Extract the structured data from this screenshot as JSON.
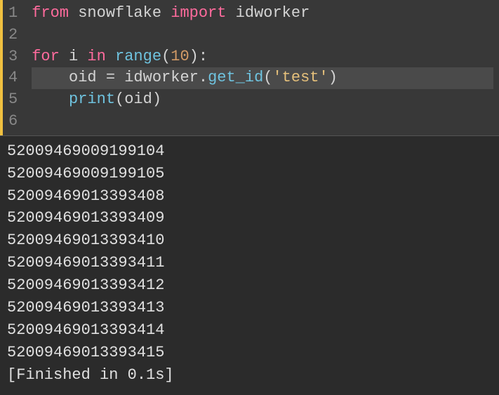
{
  "editor": {
    "lines": [
      {
        "num": "1",
        "tokens": [
          {
            "t": "from ",
            "c": "kw-import"
          },
          {
            "t": "snowflake ",
            "c": "mod"
          },
          {
            "t": "import ",
            "c": "kw-import"
          },
          {
            "t": "idworker",
            "c": "mod"
          }
        ]
      },
      {
        "num": "2",
        "tokens": []
      },
      {
        "num": "3",
        "tokens": [
          {
            "t": "for ",
            "c": "kw-control"
          },
          {
            "t": "i ",
            "c": "var"
          },
          {
            "t": "in ",
            "c": "kw-control"
          },
          {
            "t": "range",
            "c": "builtin"
          },
          {
            "t": "(",
            "c": "punct"
          },
          {
            "t": "10",
            "c": "num"
          },
          {
            "t": "):",
            "c": "punct"
          }
        ]
      },
      {
        "num": "4",
        "current": true,
        "tokens": [
          {
            "t": "    oid ",
            "c": "var"
          },
          {
            "t": "= ",
            "c": "punct"
          },
          {
            "t": "idworker",
            "c": "mod"
          },
          {
            "t": ".",
            "c": "punct"
          },
          {
            "t": "get_id",
            "c": "fn"
          },
          {
            "t": "(",
            "c": "punct"
          },
          {
            "t": "'test'",
            "c": "str"
          },
          {
            "t": ")",
            "c": "punct"
          }
        ]
      },
      {
        "num": "5",
        "tokens": [
          {
            "t": "    ",
            "c": "var"
          },
          {
            "t": "print",
            "c": "builtin"
          },
          {
            "t": "(",
            "c": "punct"
          },
          {
            "t": "oid",
            "c": "var"
          },
          {
            "t": ")",
            "c": "punct"
          }
        ]
      },
      {
        "num": "6",
        "tokens": []
      }
    ]
  },
  "output": {
    "lines": [
      "52009469009199104",
      "52009469009199105",
      "52009469013393408",
      "52009469013393409",
      "52009469013393410",
      "52009469013393411",
      "52009469013393412",
      "52009469013393413",
      "52009469013393414",
      "52009469013393415",
      "[Finished in 0.1s]"
    ]
  }
}
